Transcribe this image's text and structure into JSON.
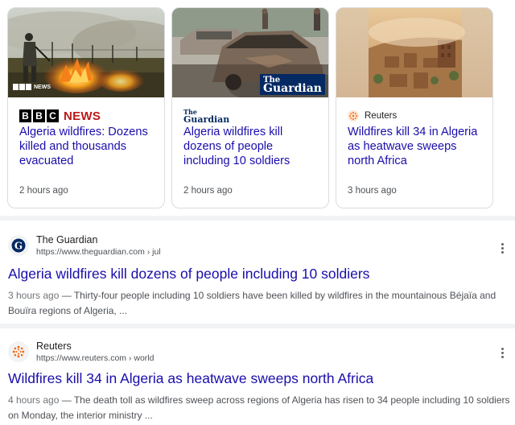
{
  "top_stories": [
    {
      "source": "BBC NEWS",
      "source_blocks": [
        "B",
        "B",
        "C"
      ],
      "source_word": "NEWS",
      "thumb_badge": "BBC NEWS",
      "title": "Algeria wildfires: Dozens killed and thousands evacuated",
      "time": "2 hours ago"
    },
    {
      "source": "The Guardian",
      "thumb_badge_line1": "The",
      "thumb_badge_line2": "Guardian",
      "title": "Algeria wildfires kill dozens of people including 10 soldiers",
      "time": "2 hours ago"
    },
    {
      "source": "Reuters",
      "title": "Wildfires kill 34 in Algeria as heatwave sweeps north Africa",
      "time": "3 hours ago"
    }
  ],
  "results": [
    {
      "site_name": "The Guardian",
      "url": "https://www.theguardian.com",
      "crumb": "› jul",
      "title": "Algeria wildfires kill dozens of people including 10 soldiers",
      "date": "3 hours ago",
      "snippet": " — Thirty-four people including 10 soldiers have been killed by wildfires in the mountainous Béjaïa and Bouïra regions of Algeria, ..."
    },
    {
      "site_name": "Reuters",
      "url": "https://www.reuters.com",
      "crumb": "› world",
      "title": "Wildfires kill 34 in Algeria as heatwave sweeps north Africa",
      "date": "4 hours ago",
      "snippet": " — The death toll as wildfires sweep across regions of Algeria has risen to 34 people including 10 soldiers on Monday, the interior ministry ..."
    }
  ],
  "icons": {
    "guardian_favicon": "guardian-g-icon",
    "reuters_favicon": "reuters-dots-icon",
    "more": "more-vert-icon"
  },
  "colors": {
    "link": "#1a0dab",
    "bbc_red": "#bb1919",
    "guardian_navy": "#052962",
    "reuters_orange": "#fa6400",
    "divider": "#f1f3f4"
  }
}
